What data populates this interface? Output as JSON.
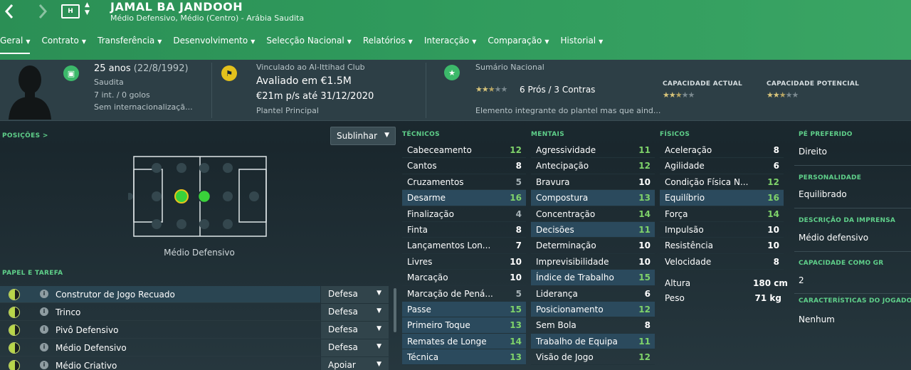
{
  "header": {
    "back_icon": "chevron-left-icon",
    "forward_icon": "chevron-right-icon",
    "club_icon_text": "H",
    "player_name": "JAMAL BA JANDOOH",
    "player_sub": "Médio Defensivo, Médio (Centro) - Arábia Saudita",
    "colors": {
      "accent": "#2f9a5c"
    }
  },
  "tabs": [
    {
      "label": "Geral"
    },
    {
      "label": "Contrato"
    },
    {
      "label": "Transferência"
    },
    {
      "label": "Desenvolvimento"
    },
    {
      "label": "Selecção Nacional"
    },
    {
      "label": "Relatórios"
    },
    {
      "label": "Interacção"
    },
    {
      "label": "Comparação"
    },
    {
      "label": "Historial"
    }
  ],
  "info": {
    "age": "25 anos",
    "dob": "(22/8/1992)",
    "nationality": "Saudita",
    "caps": "7 int. / 0 golos",
    "intl_status": "Sem internacionalizaçã...",
    "contract_label": "Vinculado ao Al-Ittihad Club",
    "value": "Avaliado em €1.5M",
    "wage": "€21m p/s até 31/12/2020",
    "squad_status": "Plantel Principal",
    "national_summary_label": "Sumário Nacional",
    "pros_cons": "6 Prós / 3 Contras",
    "national_status": "Elemento integrante do plantel mas que aind...",
    "current_ability_label": "CAPACIDADE ACTUAL",
    "potential_ability_label": "CAPACIDADE POTENCIAL",
    "summary_stars": 2.5,
    "current_ability_stars": 2.5,
    "potential_ability_stars": 2.5
  },
  "positions": {
    "label": "POSIÇÕES",
    "label_chevron": ">",
    "dropdown": "Sublinhar",
    "caption": "Médio Defensivo"
  },
  "roles": {
    "label": "PAPEL E TAREFA",
    "items": [
      {
        "name": "Construtor de Jogo Recuado",
        "duty": "Defesa",
        "fill": "half"
      },
      {
        "name": "Trinco",
        "duty": "Defesa",
        "fill": "half"
      },
      {
        "name": "Pivô Defensivo",
        "duty": "Defesa",
        "fill": "half"
      },
      {
        "name": "Médio Defensivo",
        "duty": "Defesa",
        "fill": "half"
      },
      {
        "name": "Médio Criativo",
        "duty": "Apoiar",
        "fill": "half"
      }
    ]
  },
  "attributes": {
    "technical_label": "TÉCNICOS",
    "mental_label": "MENTAIS",
    "physical_label": "FÍSICOS",
    "technical": [
      {
        "name": "Cabeceamento",
        "value": "12"
      },
      {
        "name": "Cantos",
        "value": "8"
      },
      {
        "name": "Cruzamentos",
        "value": "5"
      },
      {
        "name": "Desarme",
        "value": "16"
      },
      {
        "name": "Finalização",
        "value": "4"
      },
      {
        "name": "Finta",
        "value": "8"
      },
      {
        "name": "Lançamentos Lon...",
        "value": "7"
      },
      {
        "name": "Livres",
        "value": "10"
      },
      {
        "name": "Marcação",
        "value": "10"
      },
      {
        "name": "Marcação de Pená...",
        "value": "5"
      },
      {
        "name": "Passe",
        "value": "15"
      },
      {
        "name": "Primeiro Toque",
        "value": "13"
      },
      {
        "name": "Remates de Longe",
        "value": "14"
      },
      {
        "name": "Técnica",
        "value": "13"
      }
    ],
    "mental": [
      {
        "name": "Agressividade",
        "value": "11"
      },
      {
        "name": "Antecipação",
        "value": "12"
      },
      {
        "name": "Bravura",
        "value": "10"
      },
      {
        "name": "Compostura",
        "value": "13"
      },
      {
        "name": "Concentração",
        "value": "14"
      },
      {
        "name": "Decisões",
        "value": "11"
      },
      {
        "name": "Determinação",
        "value": "10"
      },
      {
        "name": "Imprevisibilidade",
        "value": "10"
      },
      {
        "name": "Índice de Trabalho",
        "value": "15"
      },
      {
        "name": "Liderança",
        "value": "6"
      },
      {
        "name": "Posicionamento",
        "value": "12"
      },
      {
        "name": "Sem Bola",
        "value": "8"
      },
      {
        "name": "Trabalho de Equipa",
        "value": "11"
      },
      {
        "name": "Visão de Jogo",
        "value": "12"
      }
    ],
    "physical": [
      {
        "name": "Aceleração",
        "value": "8"
      },
      {
        "name": "Agilidade",
        "value": "6"
      },
      {
        "name": "Condição Física N...",
        "value": "12"
      },
      {
        "name": "Equilíbrio",
        "value": "16"
      },
      {
        "name": "Força",
        "value": "14"
      },
      {
        "name": "Impulsão",
        "value": "10"
      },
      {
        "name": "Resistência",
        "value": "10"
      },
      {
        "name": "Velocidade",
        "value": "8"
      }
    ],
    "height_label": "Altura",
    "height_value": "180 cm",
    "weight_label": "Peso",
    "weight_value": "71 kg"
  },
  "right": {
    "foot_label": "PÉ PREFERIDO",
    "foot_value": "Direito",
    "personality_label": "PERSONALIDADE",
    "personality_value": "Equilibrado",
    "media_label": "DESCRIÇÃO DA IMPRENSA",
    "media_value": "Médio defensivo",
    "gk_label": "CAPACIDADE COMO GR",
    "gk_value": "2",
    "traits_label": "CARACTERÍSTICAS DO JOGADOR",
    "traits_value": "Nenhum"
  }
}
